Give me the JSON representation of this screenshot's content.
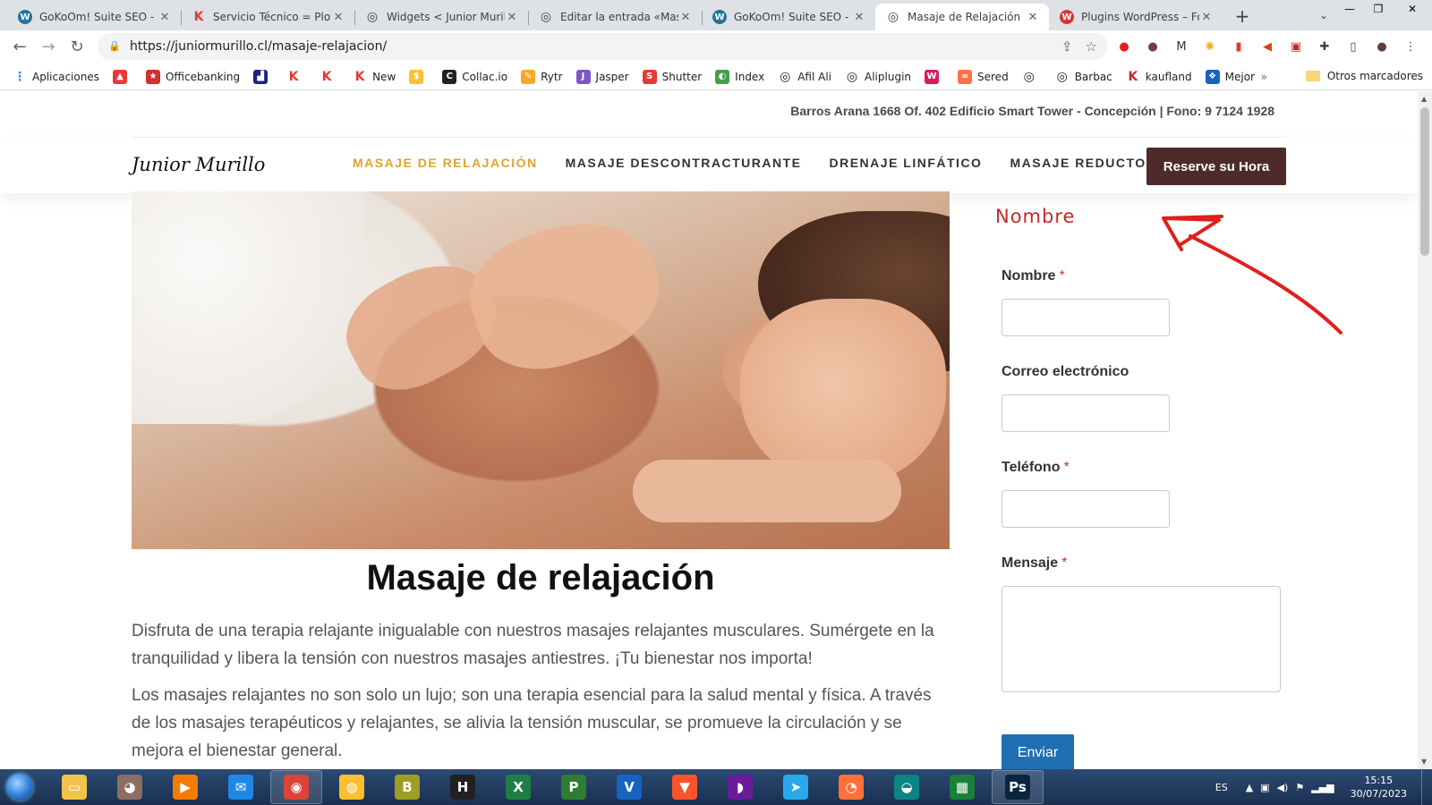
{
  "browser": {
    "tabs": [
      {
        "title": "GoKoOm! Suite SEO - Ke",
        "fav_color": "#21759b",
        "fav_glyph": "W"
      },
      {
        "title": "Servicio Técnico = Plotte",
        "fav_color": "#ffffff",
        "fav_glyph": "K"
      },
      {
        "title": "Widgets < Junior Murillo",
        "fav_color": "#3c4043",
        "fav_glyph": "◎"
      },
      {
        "title": "Editar la entrada «Masaj",
        "fav_color": "#3c4043",
        "fav_glyph": "◎"
      },
      {
        "title": "GoKoOm! Suite SEO - Ke",
        "fav_color": "#21759b",
        "fav_glyph": "W"
      },
      {
        "title": "Masaje de Relajación",
        "fav_color": "#3c4043",
        "fav_glyph": "◎",
        "active": true
      },
      {
        "title": "Plugins WordPress – For",
        "fav_color": "#d63638",
        "fav_glyph": "W"
      }
    ],
    "url": "https://juniormurillo.cl/masaje-relajacion/",
    "bookmarks": [
      {
        "label": "Aplicaciones",
        "color": "#4285f4",
        "glyph": "⋮"
      },
      {
        "label": "",
        "color": "#e53935",
        "glyph": "▲"
      },
      {
        "label": "Officebanking",
        "color": "#d32f2f",
        "glyph": "★"
      },
      {
        "label": "",
        "color": "#1a237e",
        "glyph": "▟"
      },
      {
        "label": "",
        "color": "#e53935",
        "glyph": "K"
      },
      {
        "label": "",
        "color": "#e53935",
        "glyph": "K"
      },
      {
        "label": "New",
        "color": "#e53935",
        "glyph": "K"
      },
      {
        "label": "",
        "color": "#fbc02d",
        "glyph": "$"
      },
      {
        "label": "Collac.io",
        "color": "#212121",
        "glyph": "C"
      },
      {
        "label": "Rytr",
        "color": "#f9a825",
        "glyph": "✎"
      },
      {
        "label": "Jasper",
        "color": "#7e57c2",
        "glyph": "J"
      },
      {
        "label": "Shutter",
        "color": "#e53935",
        "glyph": "S"
      },
      {
        "label": "Index",
        "color": "#43a047",
        "glyph": "◐"
      },
      {
        "label": "Afil Ali",
        "color": "#212121",
        "glyph": "◎"
      },
      {
        "label": "Aliplugin",
        "color": "#212121",
        "glyph": "◎"
      },
      {
        "label": "",
        "color": "#d81b60",
        "glyph": "W"
      },
      {
        "label": "Sered",
        "color": "#ff7043",
        "glyph": "∞"
      },
      {
        "label": "",
        "color": "#212121",
        "glyph": "◎"
      },
      {
        "label": "Barbac",
        "color": "#212121",
        "glyph": "◎"
      },
      {
        "label": "kaufland",
        "color": "#c62828",
        "glyph": "K"
      },
      {
        "label": "Mejor",
        "color": "#1565c0",
        "glyph": "❖"
      }
    ],
    "bookmarks_more": "»",
    "other_bookmarks": "Otros marcadores"
  },
  "site": {
    "topbar_info": "Barros Arana 1668 Of. 402 Edificio Smart Tower - Concepción | Fono: 9 7124 1928",
    "logo": "Junior Murillo",
    "nav": [
      "MASAJE DE RELAJACIÓN",
      "MASAJE DESCONTRACTURANTE",
      "DRENAJE LINFÁTICO",
      "MASAJE REDUCTOR"
    ],
    "cta": "Reserve su Hora",
    "title": "Masaje de relajación",
    "paragraph1": "Disfruta de una terapia relajante inigualable con nuestros masajes relajantes musculares. Sumérgete en la tranquilidad y libera la tensión con nuestros masajes antiestres. ¡Tu bienestar nos importa!",
    "paragraph2": "Los masajes relajantes no son solo un lujo; son una terapia esencial para la salud mental y física. A través de los masajes terapéuticos y relajantes, se alivia la tensión muscular, se promueve la circulación y se mejora el bienestar general.",
    "form": {
      "heading": "Nombre",
      "name_label": "Nombre",
      "email_label": "Correo electrónico",
      "phone_label": "Teléfono",
      "message_label": "Mensaje",
      "required_mark": "*",
      "submit": "Enviar"
    },
    "annotation_color": "#e0201c"
  },
  "taskbar": {
    "apps": [
      {
        "name": "explorer",
        "color": "#f2c34b",
        "glyph": "▭"
      },
      {
        "name": "gimp",
        "color": "#8d6e63",
        "glyph": "◕"
      },
      {
        "name": "media",
        "color": "#f57c00",
        "glyph": "▶"
      },
      {
        "name": "thunderbird",
        "color": "#1e88e5",
        "glyph": "✉"
      },
      {
        "name": "chrome",
        "color": "#db4437",
        "glyph": "◉",
        "active": true
      },
      {
        "name": "globe",
        "color": "#fbc02d",
        "glyph": "◍"
      },
      {
        "name": "b-app",
        "color": "#9e9d24",
        "glyph": "B"
      },
      {
        "name": "h-app",
        "color": "#212121",
        "glyph": "H"
      },
      {
        "name": "excel",
        "color": "#1e7e45",
        "glyph": "X"
      },
      {
        "name": "project",
        "color": "#2e7d32",
        "glyph": "P"
      },
      {
        "name": "visio",
        "color": "#1565c0",
        "glyph": "V"
      },
      {
        "name": "brave",
        "color": "#fb542b",
        "glyph": "▼"
      },
      {
        "name": "podcast",
        "color": "#6a1b9a",
        "glyph": "◗"
      },
      {
        "name": "telegram",
        "color": "#29a9eb",
        "glyph": "➤"
      },
      {
        "name": "firefox",
        "color": "#ff7139",
        "glyph": "◔"
      },
      {
        "name": "edge",
        "color": "#0c8484",
        "glyph": "◒"
      },
      {
        "name": "sheets",
        "color": "#188038",
        "glyph": "▦"
      },
      {
        "name": "photoshop",
        "color": "#0a2540",
        "glyph": "Ps",
        "active": true
      }
    ],
    "lang": "ES",
    "time": "15:15",
    "date": "30/07/2023"
  }
}
